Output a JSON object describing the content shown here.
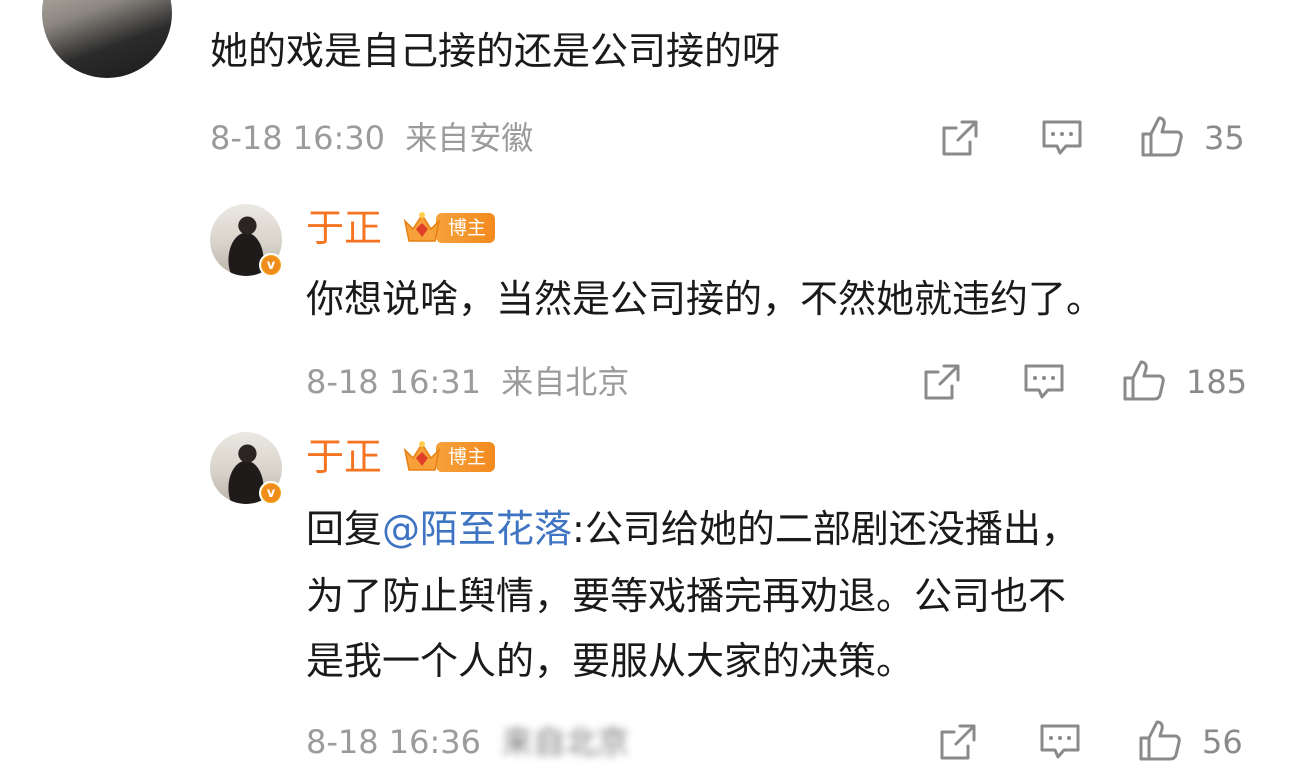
{
  "comments": [
    {
      "text": "她的戏是自己接的还是公司接的呀",
      "date": "8-18 16:30",
      "location": "来自安徽",
      "likes": "35"
    },
    {
      "username": "于正",
      "tag": "博主",
      "text": "你想说啥，当然是公司接的，不然她就违约了。",
      "date": "8-18 16:31",
      "location": "来自北京",
      "likes": "185"
    },
    {
      "username": "于正",
      "tag": "博主",
      "reply_prefix": "回复",
      "mention": "@陌至花落",
      "text_line1": ":公司给她的二部剧还没播出，",
      "text_line2": "为了防止舆情，要等戏播完再劝退。公司也不",
      "text_line3": "是我一个人的，要服从大家的决策。",
      "date": "8-18 16:36",
      "location": "来自北京",
      "likes": "56"
    }
  ],
  "icons": {
    "share": "share-icon",
    "comment": "comment-icon",
    "like": "thumbs-up-icon",
    "verified": "verified-badge-icon"
  },
  "colors": {
    "username": "#f57421",
    "mention": "#3f74c2",
    "meta": "#9b9b9b",
    "badge": "#f5a623"
  }
}
